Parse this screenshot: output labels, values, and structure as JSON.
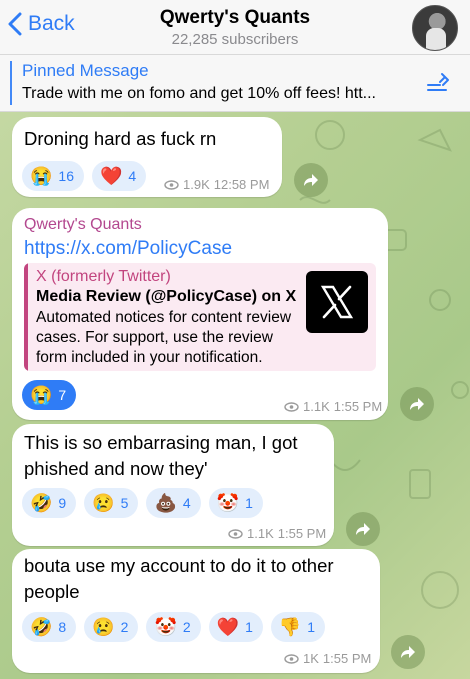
{
  "header": {
    "back_label": "Back",
    "title": "Qwerty's Quants",
    "subscribers": "22,285 subscribers"
  },
  "pinned": {
    "title": "Pinned Message",
    "text": "Trade with me on fomo and get 10% off fees! htt..."
  },
  "messages": [
    {
      "text": "Droning hard as fuck rn",
      "reactions": [
        {
          "emoji": "😭",
          "count": "16"
        },
        {
          "emoji": "❤️",
          "count": "4"
        }
      ],
      "views": "1.9K",
      "time": "12:58 PM"
    },
    {
      "channel": "Qwerty's Quants",
      "link": "https://x.com/PolicyCase",
      "preview": {
        "site": "X (formerly Twitter)",
        "title": "Media Review (@PolicyCase) on X",
        "description": "Automated notices for content review cases. For support, use the review form included in your notification."
      },
      "reactions": [
        {
          "emoji": "😭",
          "count": "7"
        }
      ],
      "views": "1.1K",
      "time": "1:55 PM"
    },
    {
      "text_line1": "This is so embarrasing man, I got",
      "text_line2": "phished and now they'",
      "reactions": [
        {
          "emoji": "🤣",
          "count": "9"
        },
        {
          "emoji": "😢",
          "count": "5"
        },
        {
          "emoji": "💩",
          "count": "4"
        },
        {
          "emoji": "🤡",
          "count": "1"
        }
      ],
      "views": "1.1K",
      "time": "1:55 PM"
    },
    {
      "text_line1": "bouta use my account to do it to other",
      "text_line2": "people",
      "reactions": [
        {
          "emoji": "🤣",
          "count": "8"
        },
        {
          "emoji": "😢",
          "count": "2"
        },
        {
          "emoji": "🤡",
          "count": "2"
        },
        {
          "emoji": "❤️",
          "count": "1"
        },
        {
          "emoji": "👎",
          "count": "1"
        }
      ],
      "views": "1K",
      "time": "1:55 PM"
    }
  ],
  "colors": {
    "accent": "#2f7cf6",
    "channel_name": "#b3488f",
    "preview_accent": "#c2457f"
  }
}
